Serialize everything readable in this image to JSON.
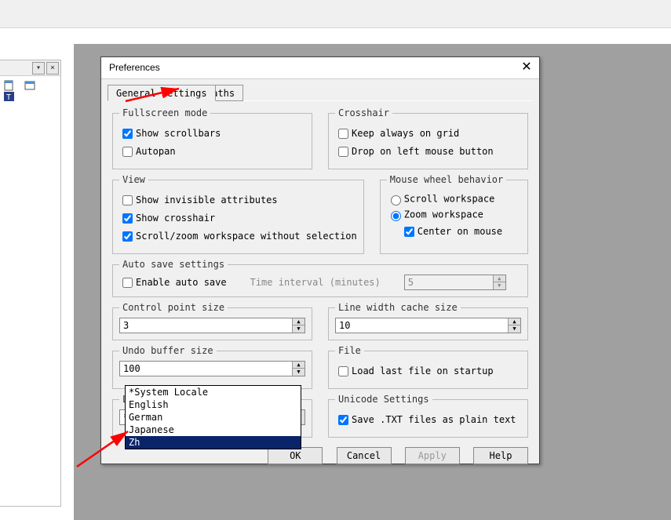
{
  "dialog": {
    "title": "Preferences",
    "tabs": {
      "general": "General Settings",
      "paths": "Paths"
    }
  },
  "fullscreen": {
    "legend": "Fullscreen mode",
    "show_scrollbars": "Show scrollbars",
    "autopan": "Autopan"
  },
  "crosshair": {
    "legend": "Crosshair",
    "keep_on_grid": "Keep always on grid",
    "drop_on_left": "Drop on left mouse button"
  },
  "view": {
    "legend": "View",
    "show_invisible": "Show invisible attributes",
    "show_crosshair": "Show crosshair",
    "scroll_zoom_nosel": "Scroll/zoom workspace without selection"
  },
  "wheel": {
    "legend": "Mouse wheel behavior",
    "scroll_ws": "Scroll workspace",
    "zoom_ws": "Zoom workspace",
    "center_on_mouse": "Center on mouse"
  },
  "autosave": {
    "legend": "Auto save settings",
    "enable": "Enable auto save",
    "interval_label": "Time interval (minutes)",
    "interval_value": "5"
  },
  "cpsize": {
    "legend": "Control point size",
    "value": "3"
  },
  "lwcache": {
    "legend": "Line width cache size",
    "value": "10"
  },
  "undo": {
    "legend": "Undo buffer size",
    "value": "100"
  },
  "file": {
    "legend": "File",
    "load_last": "Load last file on startup"
  },
  "language": {
    "legend": "Language",
    "selected": "*System Locale",
    "options": [
      "*System Locale",
      "English",
      "German",
      "Japanese",
      "Zh"
    ],
    "highlight": "Zh"
  },
  "unicode": {
    "legend": "Unicode Settings",
    "save_plain": "Save .TXT files as plain text"
  },
  "buttons": {
    "ok": "OK",
    "cancel": "Cancel",
    "apply": "Apply",
    "help": "Help"
  }
}
